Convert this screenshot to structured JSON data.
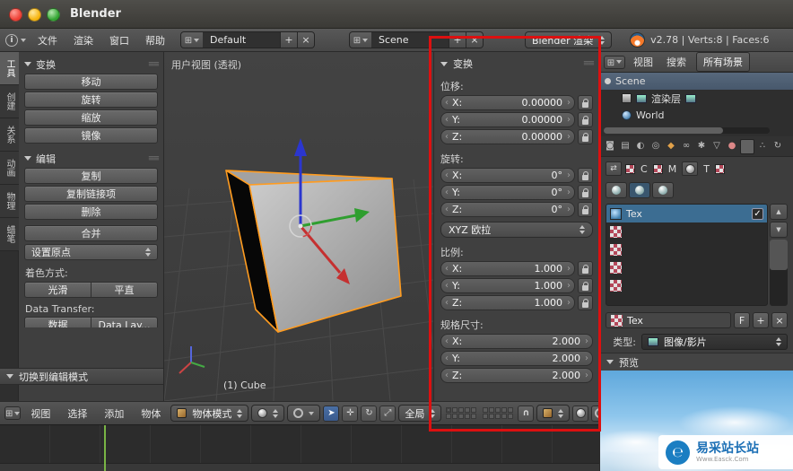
{
  "colors": {
    "highlight_box": "#dc1010",
    "selection_blue": "#3c6d92",
    "object_outline": "#ff9c20",
    "axis_x": "#c53030",
    "axis_y": "#2f9e2f",
    "axis_z": "#2b36cf",
    "timeline_cursor": "#79b445"
  },
  "window": {
    "title": "Blender"
  },
  "menubar": {
    "menus": [
      "文件",
      "渲染",
      "窗口",
      "帮助"
    ],
    "screen_value": "Default",
    "scene_value": "Scene",
    "engine_value": "Blender 渲染",
    "stats": "v2.78 | Verts:8 | Faces:6"
  },
  "toolshelf": {
    "tabs": [
      "工具",
      "创建",
      "关系",
      "动画",
      "物理",
      "蜡笔"
    ],
    "transform_title": "变换",
    "move": "移动",
    "rotate": "旋转",
    "scale": "缩放",
    "mirror": "镜像",
    "edit_title": "编辑",
    "duplicate": "复制",
    "duplicate_linked": "复制链接项",
    "delete": "删除",
    "join": "合并",
    "set_origin": "设置原点",
    "shading_label": "着色方式:",
    "smooth": "光滑",
    "flat": "平直",
    "data_transfer_label": "Data Transfer:",
    "data_button": "数据",
    "data_layout_button": "Data Lay...",
    "edit_mode_toggle": "切换到编辑模式"
  },
  "viewport": {
    "view_label": "用户视图 (透视)",
    "object_label": "(1) Cube"
  },
  "npanel": {
    "title": "变换",
    "location_label": "位移:",
    "loc": [
      {
        "a": "X:",
        "v": "0.00000"
      },
      {
        "a": "Y:",
        "v": "0.00000"
      },
      {
        "a": "Z:",
        "v": "0.00000"
      }
    ],
    "rotation_label": "旋转:",
    "rot": [
      {
        "a": "X:",
        "v": "0°"
      },
      {
        "a": "Y:",
        "v": "0°"
      },
      {
        "a": "Z:",
        "v": "0°"
      }
    ],
    "rotation_mode": "XYZ 欧拉",
    "scale_label": "比例:",
    "scl": [
      {
        "a": "X:",
        "v": "1.000"
      },
      {
        "a": "Y:",
        "v": "1.000"
      },
      {
        "a": "Z:",
        "v": "1.000"
      }
    ],
    "dimensions_label": "规格尺寸:",
    "dim": [
      {
        "a": "X:",
        "v": "2.000"
      },
      {
        "a": "Y:",
        "v": "2.000"
      },
      {
        "a": "Z:",
        "v": "2.000"
      }
    ]
  },
  "outliner": {
    "view_menu": "视图",
    "search_menu": "搜索",
    "scenes_filter": "所有场景",
    "scene_item": "Scene",
    "render_layers_item": "渲染层",
    "world_item": "World"
  },
  "properties": {
    "context_letters": [
      "C",
      "M",
      "T"
    ],
    "texture_item": "Tex",
    "name_value": "Tex",
    "fake_user": "F",
    "type_label": "类型:",
    "type_value": "图像/影片",
    "preview_title": "预览"
  },
  "bottombar": {
    "menus": [
      "视图",
      "选择",
      "添加",
      "物体"
    ],
    "mode_value": "物体模式",
    "orientation_value": "全局"
  },
  "watermark": {
    "brand": "易采站长站",
    "url": "Www.Easck.Com"
  }
}
